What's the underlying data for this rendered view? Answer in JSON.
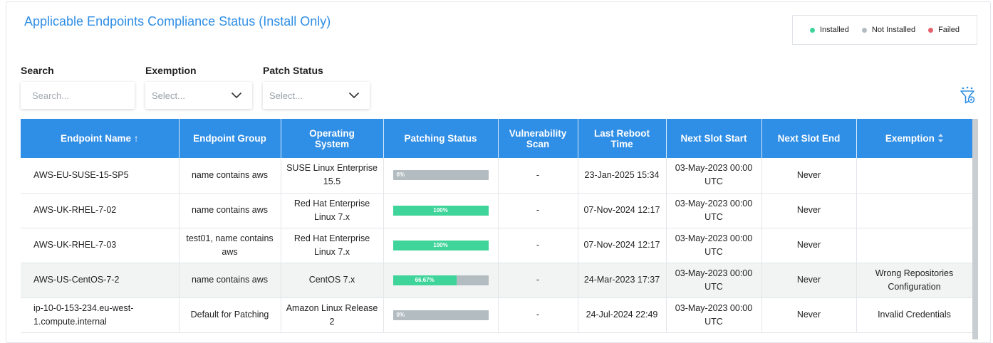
{
  "page": {
    "title": "Applicable Endpoints Compliance Status (Install Only)"
  },
  "legend": [
    {
      "label": "Installed",
      "color": "#3fd49a"
    },
    {
      "label": "Not Installed",
      "color": "#b2bcc1"
    },
    {
      "label": "Failed",
      "color": "#e5606c"
    }
  ],
  "filters": {
    "search": {
      "label": "Search",
      "placeholder": "Search..."
    },
    "exemption": {
      "label": "Exemption",
      "placeholder": "Select..."
    },
    "patch_status": {
      "label": "Patch Status",
      "placeholder": "Select..."
    }
  },
  "icons": {
    "filter_reset": "filter-reset-icon",
    "sort_ascending": "arrow-up-icon",
    "column_sort": "sort-icon"
  },
  "table": {
    "columns": [
      {
        "label": "Endpoint Name ↑"
      },
      {
        "label": "Endpoint Group"
      },
      {
        "label": "Operating System"
      },
      {
        "label": "Patching Status"
      },
      {
        "label": "Vulnerability Scan"
      },
      {
        "label": "Last Reboot Time"
      },
      {
        "label": "Next Slot Start"
      },
      {
        "label": "Next Slot End"
      },
      {
        "label": "Exemption"
      }
    ],
    "rows": [
      {
        "name": "AWS-EU-SUSE-15-SP5",
        "group": "name contains aws",
        "os": "SUSE Linux Enterprise 15.5",
        "status_label": "0%",
        "status_value": 0,
        "scan": "-",
        "reboot": "23-Jan-2025 15:34",
        "slot_start": "03-May-2023 00:00 UTC",
        "slot_end": "Never",
        "exemption": ""
      },
      {
        "name": "AWS-UK-RHEL-7-02",
        "group": "name contains aws",
        "os": "Red Hat Enterprise Linux 7.x",
        "status_label": "100%",
        "status_value": 100,
        "scan": "-",
        "reboot": "07-Nov-2024 12:17",
        "slot_start": "03-May-2023 00:00 UTC",
        "slot_end": "Never",
        "exemption": ""
      },
      {
        "name": "AWS-UK-RHEL-7-03",
        "group": "test01, name contains aws",
        "os": "Red Hat Enterprise Linux 7.x",
        "status_label": "100%",
        "status_value": 100,
        "scan": "-",
        "reboot": "07-Nov-2024 12:17",
        "slot_start": "03-May-2023 00:00 UTC",
        "slot_end": "Never",
        "exemption": ""
      },
      {
        "name": "AWS-US-CentOS-7-2",
        "group": "name contains aws",
        "os": "CentOS 7.x",
        "status_label": "66.67%",
        "status_value": 66.67,
        "scan": "-",
        "reboot": "24-Mar-2023 17:37",
        "slot_start": "03-May-2023 00:00 UTC",
        "slot_end": "Never",
        "exemption": "Wrong Repositories Configuration"
      },
      {
        "name": "ip-10-0-153-234.eu-west-1.compute.internal",
        "group": "Default for Patching",
        "os": "Amazon Linux Release 2",
        "status_label": "0%",
        "status_value": 0,
        "scan": "-",
        "reboot": "24-Jul-2024 22:49",
        "slot_start": "03-May-2023 00:00 UTC",
        "slot_end": "Never",
        "exemption": "Invalid Credentials"
      }
    ]
  }
}
